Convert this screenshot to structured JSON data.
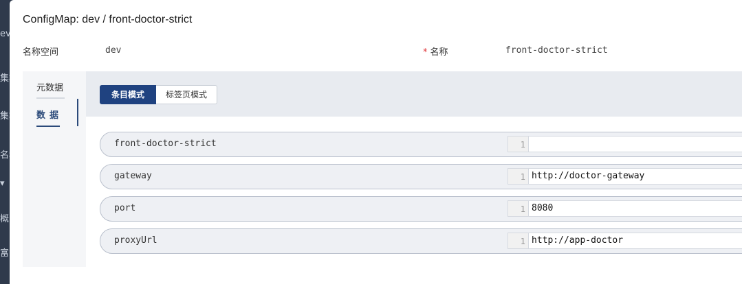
{
  "background_sidebar": {
    "fragments": [
      "ev",
      "集群",
      "集群",
      "名称",
      "▾",
      "概",
      "富"
    ]
  },
  "modal": {
    "title": "ConfigMap: dev / front-doctor-strict",
    "namespace_label": "名称空间",
    "namespace_value": "dev",
    "required_mark": "*",
    "name_label": "名称",
    "name_value": "front-doctor-strict"
  },
  "nav": {
    "items": [
      {
        "label": "元数据"
      },
      {
        "label": "数据"
      }
    ]
  },
  "mode_tabs": {
    "entry_mode": "条目模式",
    "tab_mode": "标签页模式"
  },
  "entries": [
    {
      "key": "front-doctor-strict",
      "line": "1",
      "value": ""
    },
    {
      "key": "gateway",
      "line": "1",
      "value": "http://doctor-gateway"
    },
    {
      "key": "port",
      "line": "1",
      "value": "8080"
    },
    {
      "key": "proxyUrl",
      "line": "1",
      "value": "http://app-doctor"
    }
  ],
  "colors": {
    "primary": "#1f4280",
    "required": "#e0393e",
    "sidebar_bg": "#2f3a4c"
  }
}
